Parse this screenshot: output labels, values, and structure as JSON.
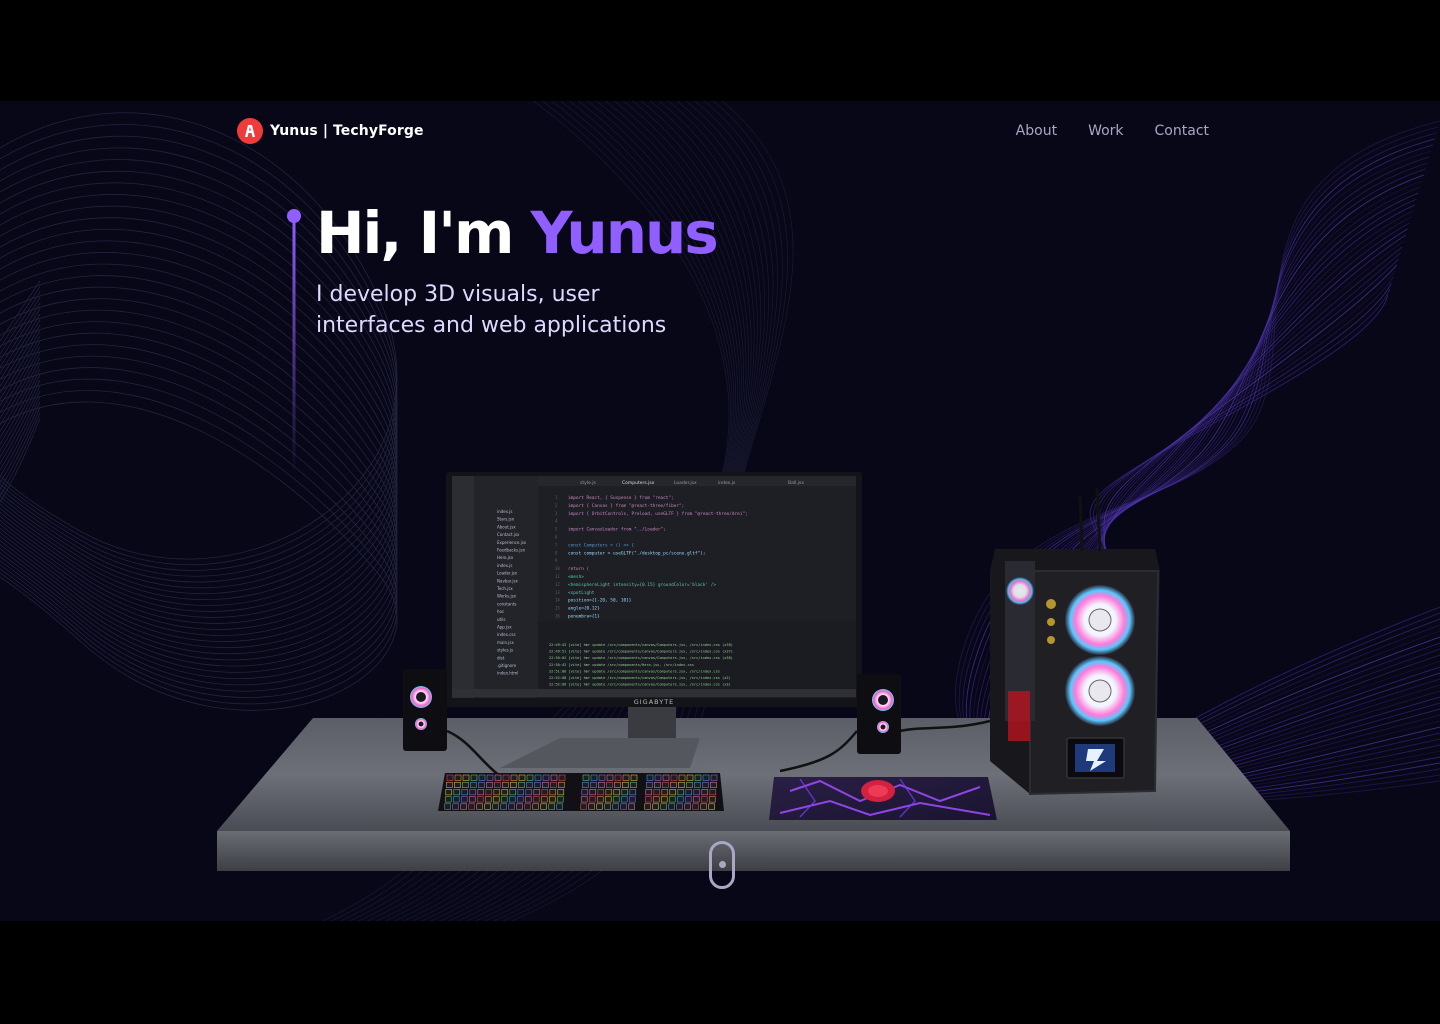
{
  "brand": {
    "name": "Yunus | TechyForge",
    "logo_letter": "A"
  },
  "nav": {
    "links": [
      "About",
      "Work",
      "Contact"
    ]
  },
  "hero": {
    "greeting": "Hi, I'm ",
    "name": "Yunus",
    "subtitle_line1": "I develop 3D visuals, user",
    "subtitle_line2": "interfaces and web applications"
  },
  "scene": {
    "monitor_brand": "GIGABYTE",
    "editor_tabs": [
      "style.js",
      "Computers.jsx",
      "Loader.jsx",
      "index.js",
      "Ball.jsx"
    ],
    "code_lines": [
      "import React, { Suspense } from \"react\";",
      "import { Canvas } from \"@react-three/fiber\";",
      "import { OrbitControls, Preload, useGLTF } from \"@react-three/drei\";",
      "",
      "import CanvasLoader from \"../Loader\";",
      "",
      "const Computers = () => {",
      "  const computer = useGLTF(\"./desktop_pc/scene.gltf\");",
      "",
      "  return (",
      "    <mesh>",
      "      <hemisphereLight intensity={0.15} groundColor='black' />",
      "      <spotLight",
      "        position={[-20, 50, 10]}",
      "        angle={0.12}",
      "        penumbra={1}"
    ],
    "file_tree": [
      "index.js",
      "Stars.jsx",
      "About.jsx",
      "Contact.jsx",
      "Experience.jsx",
      "Feedbacks.jsx",
      "Hero.jsx",
      "index.js",
      "Loader.jsx",
      "Navbar.jsx",
      "Tech.jsx",
      "Works.jsx",
      "constants",
      "hoc",
      "utils",
      "App.jsx",
      "index.css",
      "main.jsx",
      "styles.js",
      "dist",
      ".gitignore",
      "index.html"
    ],
    "terminal_lines": [
      "22:49:43 [vite] hmr update /src/components/canvas/Computers.jsx, /src/index.css (x38)",
      "22:49:51 [vite] hmr update /src/components/canvas/Computers.jsx, /src/index.css (x37)",
      "22:50:02 [vite] hmr update /src/components/canvas/Computers.jsx, /src/index.css (x38)",
      "22:50:42 [vite] hmr update /src/components/Hero.jsx, /src/index.css",
      "22:51:06 [vite] hmr update /src/components/canvas/Computers.jsx, /src/index.css",
      "22:52:08 [vite] hmr update /src/components/canvas/Computers.jsx, /src/index.css (x2)",
      "22:52:09 [vite] hmr update /src/components/canvas/Computers.jsx, /src/index.css (x3)"
    ]
  },
  "colors": {
    "accent": "#915eff",
    "background": "#070718",
    "text_secondary": "#aaa6c3",
    "logo_red": "#ee3b3b"
  },
  "icons": {
    "logo": "logo-icon",
    "scroll": "mouse-scroll-icon"
  }
}
